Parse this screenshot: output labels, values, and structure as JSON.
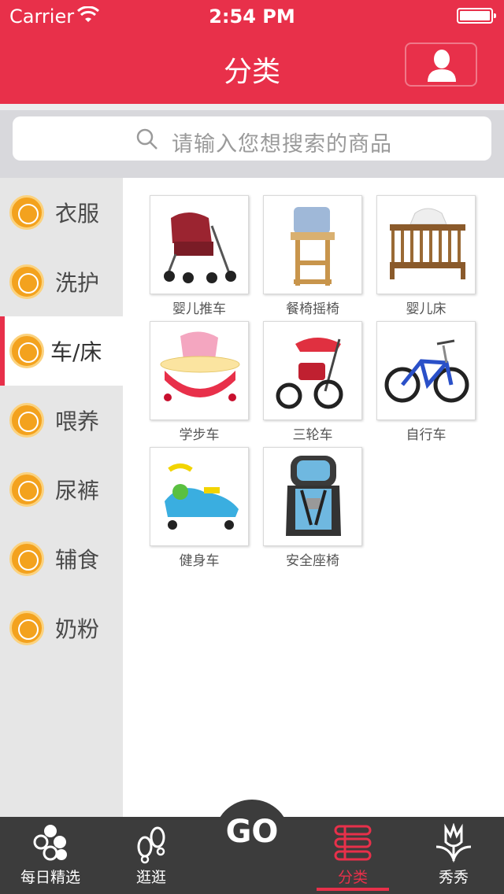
{
  "status_bar": {
    "carrier": "Carrier",
    "time": "2:54 PM"
  },
  "header": {
    "title": "分类"
  },
  "search": {
    "placeholder": "请输入您想搜索的商品"
  },
  "sidebar": {
    "items": [
      {
        "label": "衣服",
        "icon": "clothes-icon",
        "active": false
      },
      {
        "label": "洗护",
        "icon": "bath-icon",
        "active": false
      },
      {
        "label": "车/床",
        "icon": "stroller-icon",
        "active": true
      },
      {
        "label": "喂养",
        "icon": "feeding-icon",
        "active": false
      },
      {
        "label": "尿裤",
        "icon": "diaper-icon",
        "active": false
      },
      {
        "label": "辅食",
        "icon": "baby-food-icon",
        "active": false
      },
      {
        "label": "奶粉",
        "icon": "milk-bottle-icon",
        "active": false
      }
    ]
  },
  "products": [
    {
      "label": "婴儿推车",
      "icon": "stroller-image"
    },
    {
      "label": "餐椅摇椅",
      "icon": "high-chair-image"
    },
    {
      "label": "婴儿床",
      "icon": "crib-image"
    },
    {
      "label": "学步车",
      "icon": "baby-walker-image"
    },
    {
      "label": "三轮车",
      "icon": "tricycle-image"
    },
    {
      "label": "自行车",
      "icon": "bicycle-image"
    },
    {
      "label": "健身车",
      "icon": "swing-car-image"
    },
    {
      "label": "安全座椅",
      "icon": "car-seat-image"
    }
  ],
  "tabbar": {
    "tabs": [
      {
        "label": "每日精选",
        "icon": "circles-icon",
        "active": false
      },
      {
        "label": "逛逛",
        "icon": "footprints-icon",
        "active": false
      },
      {
        "label": "分类",
        "icon": "list-icon",
        "active": true
      },
      {
        "label": "秀秀",
        "icon": "tulip-icon",
        "active": false
      }
    ],
    "center_button": "GO"
  },
  "colors": {
    "accent": "#e8304a",
    "sidebar_bg": "#e6e6e6",
    "tabbar_bg": "#3c3c3c",
    "icon_orange": "#f3a21e"
  }
}
